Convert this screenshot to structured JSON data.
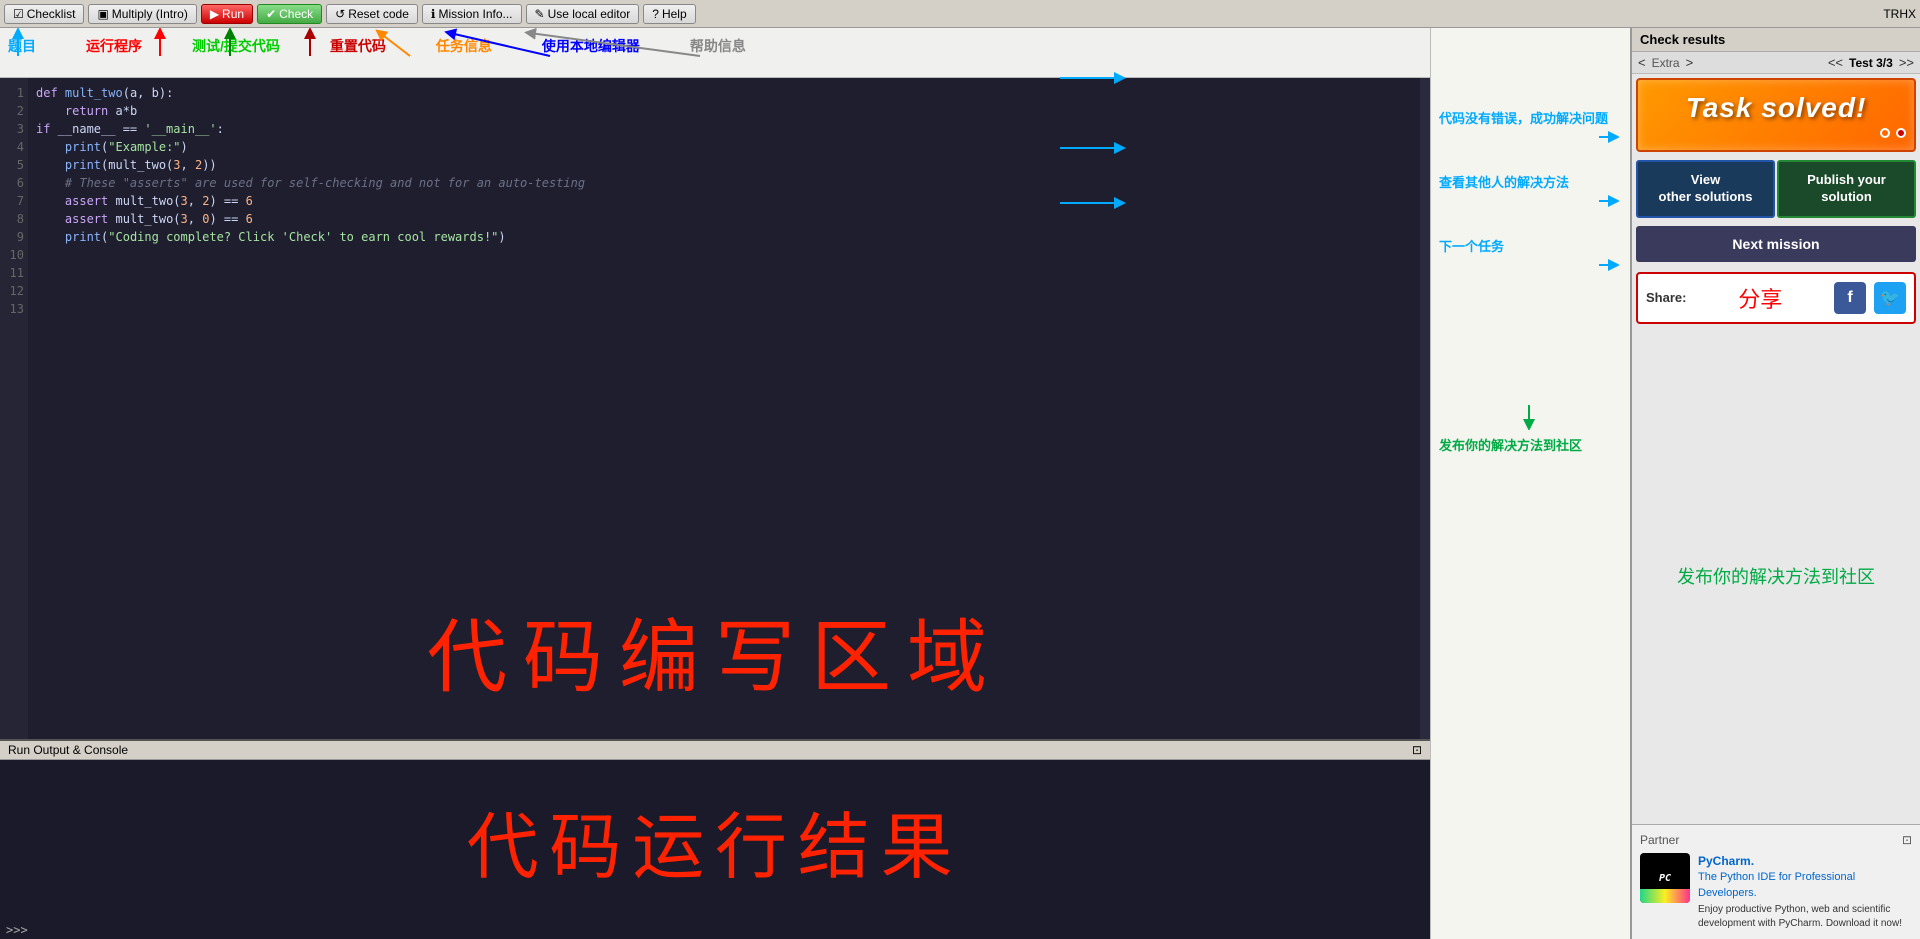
{
  "toolbar": {
    "checklist_label": "Checklist",
    "mission_label": "Multiply (Intro)",
    "run_label": "Run",
    "check_label": "Check",
    "reset_label": "Reset code",
    "mission_info_label": "Mission Info...",
    "local_editor_label": "Use local editor",
    "help_label": "Help",
    "user_label": "TRHX"
  },
  "editor": {
    "lines": [
      {
        "num": "1",
        "content": "def mult_two(a, b):"
      },
      {
        "num": "2",
        "content": "    return a*b"
      },
      {
        "num": "3",
        "content": ""
      },
      {
        "num": "4",
        "content": ""
      },
      {
        "num": "5",
        "content": "if __name__ == '__main__':"
      },
      {
        "num": "6",
        "content": "    print(\"Example:\")"
      },
      {
        "num": "7",
        "content": "    print(mult_two(3, 2))"
      },
      {
        "num": "8",
        "content": ""
      },
      {
        "num": "9",
        "content": "    # These \"asserts\" are used for self-checking and not for an auto-testing"
      },
      {
        "num": "10",
        "content": "    assert mult_two(3, 2) == 6"
      },
      {
        "num": "11",
        "content": "    assert mult_two(3, 0) == 6"
      },
      {
        "num": "12",
        "content": "    print(\"Coding complete? Click 'Check' to earn cool rewards!\")"
      },
      {
        "num": "13",
        "content": ""
      }
    ],
    "big_text": "代码编写区域"
  },
  "annotations": {
    "toolbar_labels": [
      {
        "text": "题目",
        "color": "cyan"
      },
      {
        "text": "运行程序",
        "color": "red"
      },
      {
        "text": "测试/提交代码",
        "color": "green"
      },
      {
        "text": "重置代码",
        "color": "darkred"
      },
      {
        "text": "任务信息",
        "color": "orange"
      },
      {
        "text": "使用本地编辑器",
        "color": "blue"
      },
      {
        "text": "帮助信息",
        "color": "gray"
      }
    ],
    "right_annotations": [
      {
        "text": "代码没有错误，成功解决问题",
        "color": "#00aaff"
      },
      {
        "text": "查看其他人的解决方法",
        "color": "#00aaff"
      },
      {
        "text": "下一个任务",
        "color": "#00aaff"
      },
      {
        "text": "发布你的解决方法到社区",
        "color": "#00aa44"
      }
    ]
  },
  "check_results": {
    "header": "Check results",
    "extra_label": "Extra",
    "test_label": "Test 3/3",
    "nav_left": "<",
    "nav_right": ">",
    "nav_left2": "<<",
    "nav_right2": ">>"
  },
  "task_solved": {
    "banner_text": "Task solved!",
    "view_solutions": "View\nother solutions",
    "publish_solution": "Publish your solution",
    "next_mission": "Next mission"
  },
  "share": {
    "label": "Share:",
    "chinese_text": "分享",
    "facebook_icon": "f",
    "twitter_icon": "t"
  },
  "community": {
    "text": "发布你的解决方法到社区"
  },
  "partner": {
    "header": "Partner",
    "title": "PyCharm.",
    "subtitle": "The Python IDE for Professional\nDevelopers.",
    "desc": "Enjoy productive Python, web and scientific\ndevelopment with PyCharm. Download it now!",
    "logo_text": "PC"
  },
  "console": {
    "header": "Run Output & Console",
    "big_text": "代码运行结果",
    "prompt": ">>>"
  }
}
